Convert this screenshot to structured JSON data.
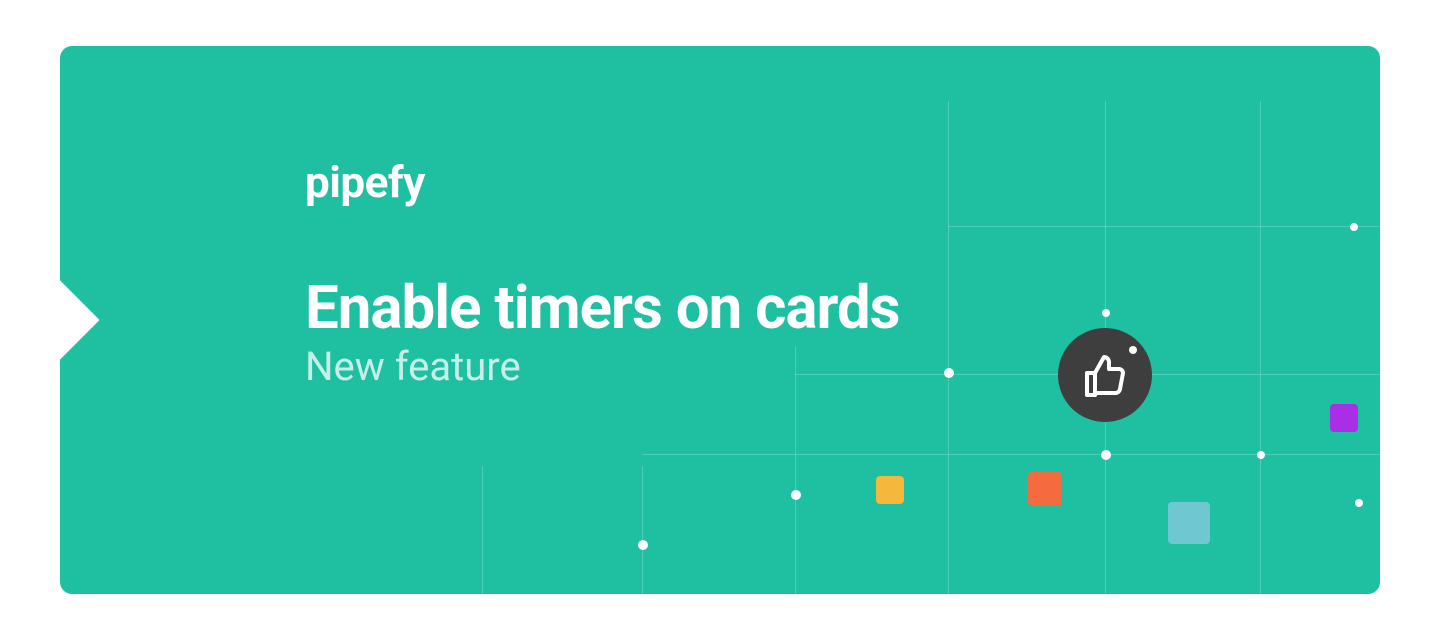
{
  "brand": {
    "name": "pipefy"
  },
  "hero": {
    "title": "Enable timers on cards",
    "subtitle": "New feature"
  },
  "colors": {
    "accent": "#1FBFA2",
    "square_yellow": "#F6B83C",
    "square_orange": "#F56A3F",
    "square_purple": "#AA2EE6",
    "square_blue": "#6FC7D1",
    "thumb_bg": "#3E3E3E"
  }
}
